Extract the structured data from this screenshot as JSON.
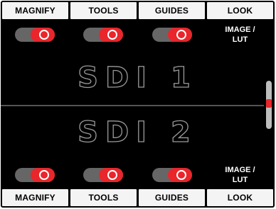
{
  "top_tabs": [
    {
      "label": "MAGNIFY"
    },
    {
      "label": "TOOLS"
    },
    {
      "label": "GUIDES"
    },
    {
      "label": "LOOK"
    }
  ],
  "bottom_tabs": [
    {
      "label": "MAGNIFY"
    },
    {
      "label": "TOOLS"
    },
    {
      "label": "GUIDES"
    },
    {
      "label": "LOOK"
    }
  ],
  "top_toggles": {
    "magnify": {
      "state": "on"
    },
    "tools": {
      "state": "on"
    },
    "guides": {
      "state": "on"
    },
    "look_label_line1": "IMAGE /",
    "look_label_line2": "LUT"
  },
  "bottom_toggles": {
    "magnify": {
      "state": "on"
    },
    "tools": {
      "state": "on"
    },
    "guides": {
      "state": "on"
    },
    "look_label_line1": "IMAGE /",
    "look_label_line2": "LUT"
  },
  "inputs": {
    "top_label": "SDI 1",
    "bottom_label": "SDI 2"
  },
  "colors": {
    "accent": "#e8262b",
    "background": "#000000",
    "tab_bg": "#f4f4f4",
    "switch_off": "#666666"
  }
}
